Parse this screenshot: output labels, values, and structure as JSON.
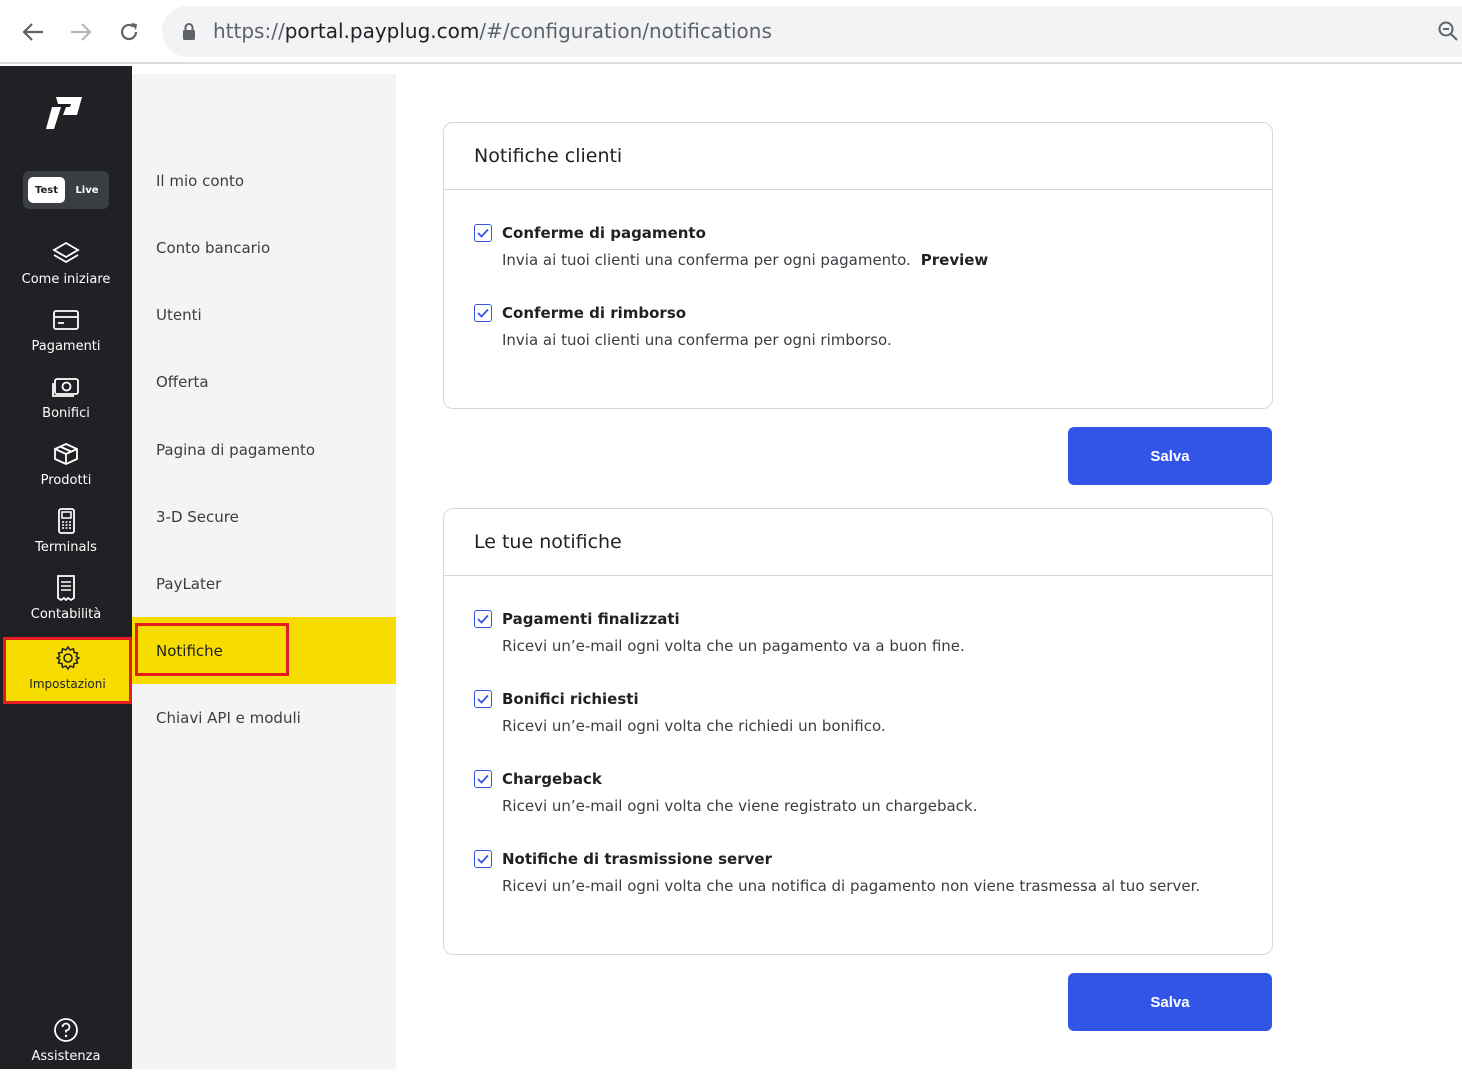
{
  "browser": {
    "url_scheme": "https://",
    "url_host": "portal.payplug.com",
    "url_path": "/#/configuration/notifications"
  },
  "sidebar": {
    "env_test": "Test",
    "env_live": "Live",
    "items": [
      {
        "label": "Come iniziare",
        "icon": "layers-icon"
      },
      {
        "label": "Pagamenti",
        "icon": "card-icon"
      },
      {
        "label": "Bonifici",
        "icon": "cash-icon"
      },
      {
        "label": "Prodotti",
        "icon": "box-icon"
      },
      {
        "label": "Terminals",
        "icon": "terminal-icon"
      },
      {
        "label": "Contabilità",
        "icon": "receipt-icon"
      },
      {
        "label": "Impostazioni",
        "icon": "gear-icon"
      }
    ],
    "help_label": "Assistenza"
  },
  "subnav": {
    "items": [
      "Il mio conto",
      "Conto bancario",
      "Utenti",
      "Offerta",
      "Pagina di pagamento",
      "3-D Secure",
      "PayLater",
      "Notifiche",
      "Chiavi API e moduli"
    ]
  },
  "customer_notifications": {
    "title": "Notifiche clienti",
    "options": [
      {
        "title": "Conferme di pagamento",
        "desc": "Invia ai tuoi clienti una conferma per ogni pagamento.",
        "link": "Preview",
        "checked": true
      },
      {
        "title": "Conferme di rimborso",
        "desc": "Invia ai tuoi clienti una conferma per ogni rimborso.",
        "checked": true
      }
    ],
    "save_label": "Salva"
  },
  "your_notifications": {
    "title": "Le tue notifiche",
    "options": [
      {
        "title": "Pagamenti finalizzati",
        "desc": "Ricevi un’e-mail ogni volta che un pagamento va a buon fine.",
        "checked": true
      },
      {
        "title": "Bonifici richiesti",
        "desc": "Ricevi un’e-mail ogni volta che richiedi un bonifico.",
        "checked": true
      },
      {
        "title": "Chargeback",
        "desc": "Ricevi un’e-mail ogni volta che viene registrato un chargeback.",
        "checked": true
      },
      {
        "title": "Notifiche di trasmissione server",
        "desc": "Ricevi un’e-mail ogni volta che una notifica di pagamento non viene trasmessa al tuo server.",
        "checked": true
      }
    ],
    "save_label": "Salva"
  },
  "colors": {
    "sidebar_bg": "#1f2124",
    "accent_yellow": "#f7dc00",
    "primary_blue": "#3255e8",
    "highlight_red": "#e41e1e"
  }
}
